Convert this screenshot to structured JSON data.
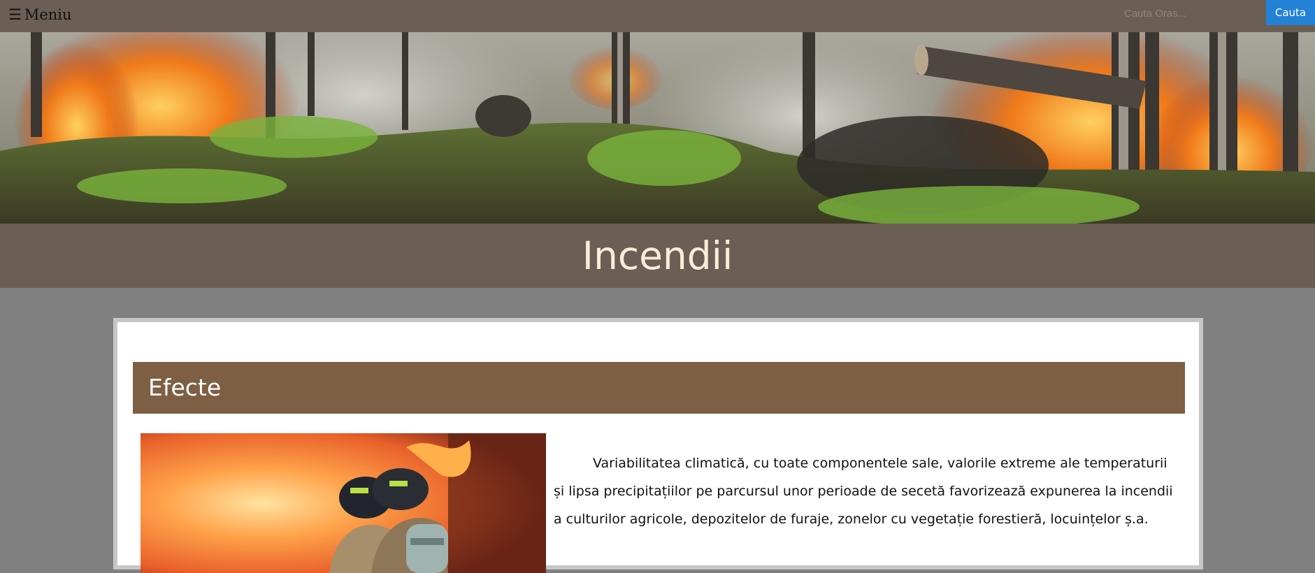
{
  "header": {
    "menu_icon": "☰",
    "menu_label": "Meniu",
    "search_placeholder": "Cauta Oras...",
    "search_value": "",
    "search_button_label": "Cauta"
  },
  "hero": {
    "image": "forest-fire-banner"
  },
  "page": {
    "title": "Incendii"
  },
  "section": {
    "heading": "Efecte",
    "image": "firefighters-in-flames",
    "paragraph": "Variabilitatea climatică, cu toate componentele sale, valorile extreme ale temperaturii și lipsa precipitațiilor pe parcursul unor perioade de secetă favorizează expunerea la incendii a culturilor agricole, depozitelor de furaje, zonelor cu vegetație forestieră, locuințelor ș.a."
  },
  "colors": {
    "header_bg": "#6b5f55",
    "page_bg": "#808080",
    "title_text": "#fbecd6",
    "section_heading_bg": "#7d5f44",
    "search_button_bg": "#2381d6",
    "card_border": "#c6c6c6"
  }
}
